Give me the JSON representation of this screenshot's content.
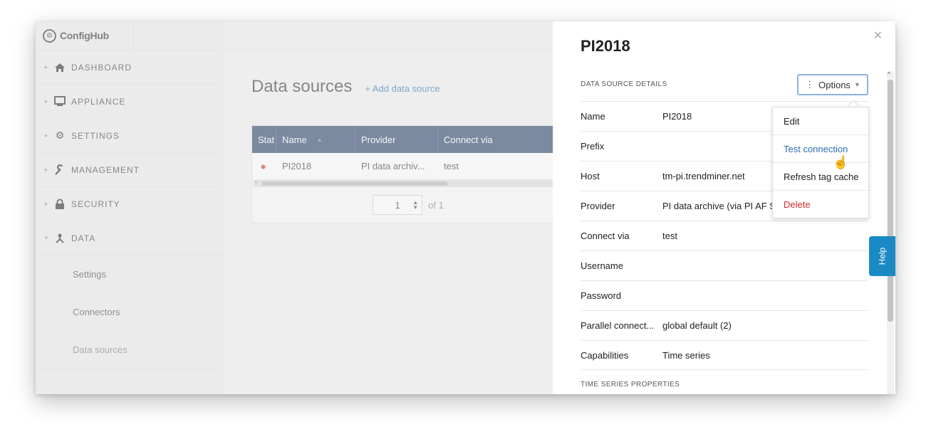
{
  "app": {
    "logo_text": "ConfigHub"
  },
  "sidebar": {
    "items": [
      {
        "label": "DASHBOARD",
        "icon": "home-icon"
      },
      {
        "label": "APPLIANCE",
        "icon": "monitor-icon"
      },
      {
        "label": "SETTINGS",
        "icon": "gear-icon"
      },
      {
        "label": "MANAGEMENT",
        "icon": "wrench-icon"
      },
      {
        "label": "SECURITY",
        "icon": "lock-icon"
      },
      {
        "label": "DATA",
        "icon": "data-network-icon"
      }
    ],
    "sub_items": [
      "Settings",
      "Connectors",
      "Data sources"
    ]
  },
  "main": {
    "title": "Data sources",
    "add_link": "+ Add data source",
    "table": {
      "headers": [
        "Stat",
        "Name",
        "Provider",
        "Connect via"
      ],
      "row": {
        "name": "PI2018",
        "provider": "PI data archiv...",
        "connect_via": "test",
        "status_color": "#d22b2b"
      }
    },
    "pager": {
      "page": "1",
      "of": "of 1"
    }
  },
  "panel": {
    "title": "PI2018",
    "details_head": "DATA SOURCE DETAILS",
    "options_label": "Options",
    "details": [
      {
        "label": "Name",
        "value": "PI2018"
      },
      {
        "label": "Prefix",
        "value": ""
      },
      {
        "label": "Host",
        "value": "tm-pi.trendminer.net"
      },
      {
        "label": "Provider",
        "value": "PI data archive (via PI AF S"
      },
      {
        "label": "Connect via",
        "value": "test"
      },
      {
        "label": "Username",
        "value": ""
      },
      {
        "label": "Password",
        "value": ""
      },
      {
        "label": "Parallel connect...",
        "value": "global default (2)"
      },
      {
        "label": "Capabilities",
        "value": "Time series"
      }
    ],
    "ts_head": "TIME SERIES PROPERTIES"
  },
  "dropdown": {
    "items": [
      {
        "label": "Edit",
        "color": "#222222"
      },
      {
        "label": "Test connection",
        "color": "#2a6db5"
      },
      {
        "label": "Refresh tag cache",
        "color": "#222222"
      },
      {
        "label": "Delete",
        "color": "#d22b2b"
      }
    ]
  },
  "help": {
    "label": "Help"
  }
}
